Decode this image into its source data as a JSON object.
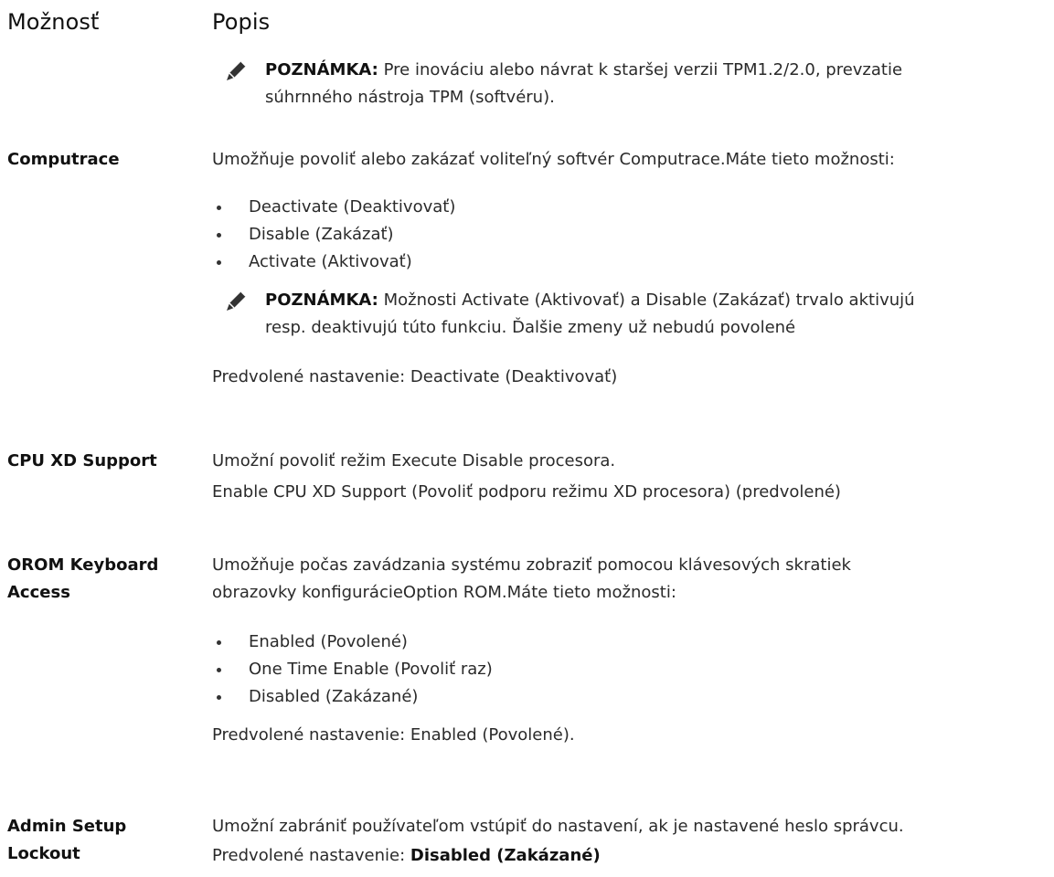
{
  "header": {
    "option": "Možnosť",
    "description": "Popis"
  },
  "note_top": {
    "title": "POZNÁMKA:",
    "line1": "Pre inováciu alebo návrat k staršej verzii TPM1.2/2.0, prevzatie",
    "line2": "súhrnného nástroja TPM (softvéru)."
  },
  "computrace": {
    "label": "Computrace",
    "desc": "Umožňuje povoliť alebo zakázať voliteľný softvér Computrace.Máte tieto možnosti:",
    "options": [
      "Deactivate (Deaktivovať)",
      "Disable (Zakázať)",
      "Activate (Aktivovať)"
    ],
    "note_title": "POZNÁMKA:",
    "note_line1": "Možnosti Activate (Aktivovať) a Disable (Zakázať) trvalo aktivujú",
    "note_line2": "resp. deaktivujú túto funkciu. Ďalšie zmeny už nebudú povolené",
    "default": "Predvolené nastavenie: Deactivate (Deaktivovať)"
  },
  "cpu_xd": {
    "label": "CPU XD Support",
    "line1": "Umožní povoliť režim Execute Disable procesora.",
    "line2": "Enable CPU XD Support (Povoliť podporu režimu XD procesora) (predvolené)"
  },
  "orom": {
    "label_line1": "OROM Keyboard",
    "label_line2": "Access",
    "desc_line1": "Umožňuje počas zavádzania systému zobraziť pomocou klávesových skratiek",
    "desc_line2": "obrazovky konfiguráciеOption ROM.Máte tieto možnosti:",
    "options": [
      "Enabled (Povolené)",
      "One Time Enable (Povoliť raz)",
      "Disabled (Zakázané)"
    ],
    "default": "Predvolené nastavenie: Enabled (Povolené)."
  },
  "admin": {
    "label_line1": "Admin Setup",
    "label_line2": "Lockout",
    "desc": "Umožní zabrániť používateľom vstúpiť do nastavení, ak je nastavené heslo správcu.",
    "default_prefix": "Predvolené nastavenie: ",
    "default_value": "Disabled (Zakázané)"
  }
}
